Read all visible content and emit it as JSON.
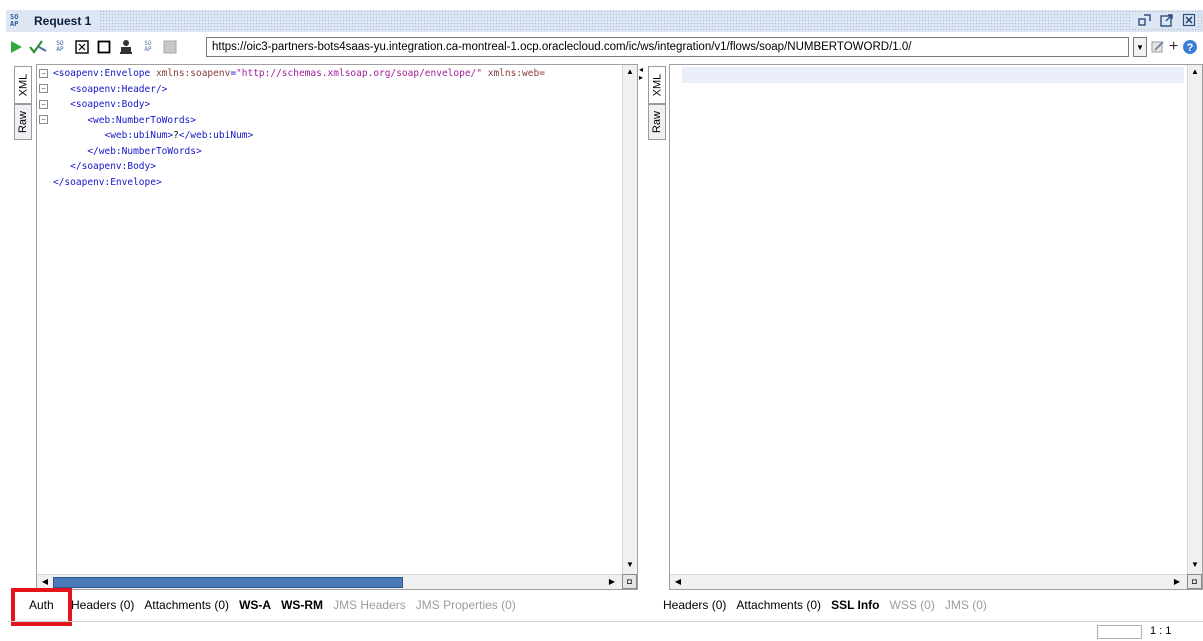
{
  "window": {
    "logo_top": "SO",
    "logo_bottom": "AP",
    "title": "Request 1",
    "controls": [
      "restore-icon",
      "maximize-icon",
      "close-icon"
    ]
  },
  "toolbar": {
    "buttons": [
      "run-icon",
      "add-assertion-icon",
      "create-empty-request-icon",
      "format-xml-icon",
      "maximize-editor-icon",
      "add-endpoint-icon",
      "soap-settings-icon",
      "stop-icon"
    ],
    "endpoint_url": "https://oic3-partners-bots4saas-yu.integration.ca-montreal-1.ocp.oraclecloud.com/ic/ws/integration/v1/flows/soap/NUMBERTOWORD/1.0/",
    "right_buttons": [
      "edit-endpoint-icon",
      "add-icon",
      "help-icon"
    ]
  },
  "request_editor": {
    "tabs": [
      "XML",
      "Raw"
    ],
    "lines": [
      {
        "indent": "",
        "parts": [
          [
            "tag",
            "<soapenv:Envelope "
          ],
          [
            "attr",
            "xmlns:soapenv"
          ],
          [
            "tag",
            "="
          ],
          [
            "val",
            "\"http://schemas.xmlsoap.org/soap/envelope/\""
          ],
          [
            "attr",
            " xmlns:web="
          ]
        ]
      },
      {
        "indent": "   ",
        "parts": [
          [
            "tag",
            "<soapenv:Header/>"
          ]
        ]
      },
      {
        "indent": "   ",
        "parts": [
          [
            "tag",
            "<soapenv:Body>"
          ]
        ]
      },
      {
        "indent": "      ",
        "parts": [
          [
            "tag",
            "<web:NumberToWords>"
          ]
        ]
      },
      {
        "indent": "         ",
        "parts": [
          [
            "tag",
            "<web:ubiNum>"
          ],
          [
            "txt",
            "?"
          ],
          [
            "tag",
            "</web:ubiNum>"
          ]
        ]
      },
      {
        "indent": "      ",
        "parts": [
          [
            "tag",
            "</web:NumberToWords>"
          ]
        ]
      },
      {
        "indent": "   ",
        "parts": [
          [
            "tag",
            "</soapenv:Body>"
          ]
        ]
      },
      {
        "indent": "",
        "parts": [
          [
            "tag",
            "</soapenv:Envelope>"
          ]
        ]
      }
    ]
  },
  "response_editor": {
    "tabs": [
      "XML",
      "Raw"
    ]
  },
  "request_tabs": {
    "auth": "Auth",
    "items": [
      {
        "label": "Headers (0)",
        "disabled": false,
        "bold": false
      },
      {
        "label": "Attachments (0)",
        "disabled": false,
        "bold": false
      },
      {
        "label": "WS-A",
        "disabled": false,
        "bold": true
      },
      {
        "label": "WS-RM",
        "disabled": false,
        "bold": true
      },
      {
        "label": "JMS Headers",
        "disabled": true,
        "bold": false
      },
      {
        "label": "JMS Properties (0)",
        "disabled": true,
        "bold": false
      }
    ]
  },
  "response_tabs": {
    "items": [
      {
        "label": "Headers (0)",
        "disabled": false,
        "bold": false
      },
      {
        "label": "Attachments (0)",
        "disabled": false,
        "bold": false
      },
      {
        "label": "SSL Info",
        "disabled": false,
        "bold": true
      },
      {
        "label": "WSS (0)",
        "disabled": true,
        "bold": false
      },
      {
        "label": "JMS (0)",
        "disabled": true,
        "bold": false
      }
    ]
  },
  "status": {
    "cursor_position": "1 : 1"
  },
  "colors": {
    "highlight_box": "#e5141b",
    "xml_tag": "#1616c8",
    "xml_value": "#a0209a",
    "scroll_thumb": "#4a7ab8"
  }
}
